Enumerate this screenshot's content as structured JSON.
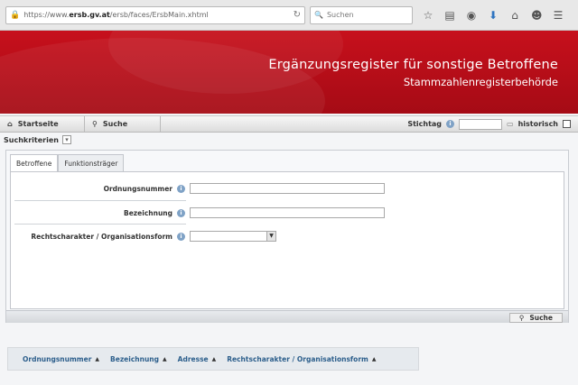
{
  "browser": {
    "url_prefix": "https://www.",
    "url_domain": "ersb.gv.at",
    "url_path": "/ersb/faces/ErsbMain.xhtml",
    "search_placeholder": "Suchen"
  },
  "banner": {
    "title": "Ergänzungsregister für sonstige Betroffene",
    "subtitle": "Stammzahlenregisterbehörde",
    "color": "#b80e19"
  },
  "nav": {
    "home_label": "Startseite",
    "search_label": "Suche",
    "stichtag_label": "Stichtag",
    "historisch_label": "historisch"
  },
  "criteria": {
    "label": "Suchkriterien"
  },
  "tabs": [
    {
      "label": "Betroffene",
      "active": true
    },
    {
      "label": "Funktionsträger",
      "active": false
    }
  ],
  "form": {
    "ordnungsnummer_label": "Ordnungsnummer",
    "bezeichnung_label": "Bezeichnung",
    "rechtscharakter_label": "Rechtscharakter / Organisationsform",
    "search_button_label": "Suche"
  },
  "results": {
    "columns": [
      {
        "label": "Ordnungsnummer"
      },
      {
        "label": "Bezeichnung"
      },
      {
        "label": "Adresse"
      },
      {
        "label": "Rechtscharakter / Organisationsform"
      }
    ]
  }
}
